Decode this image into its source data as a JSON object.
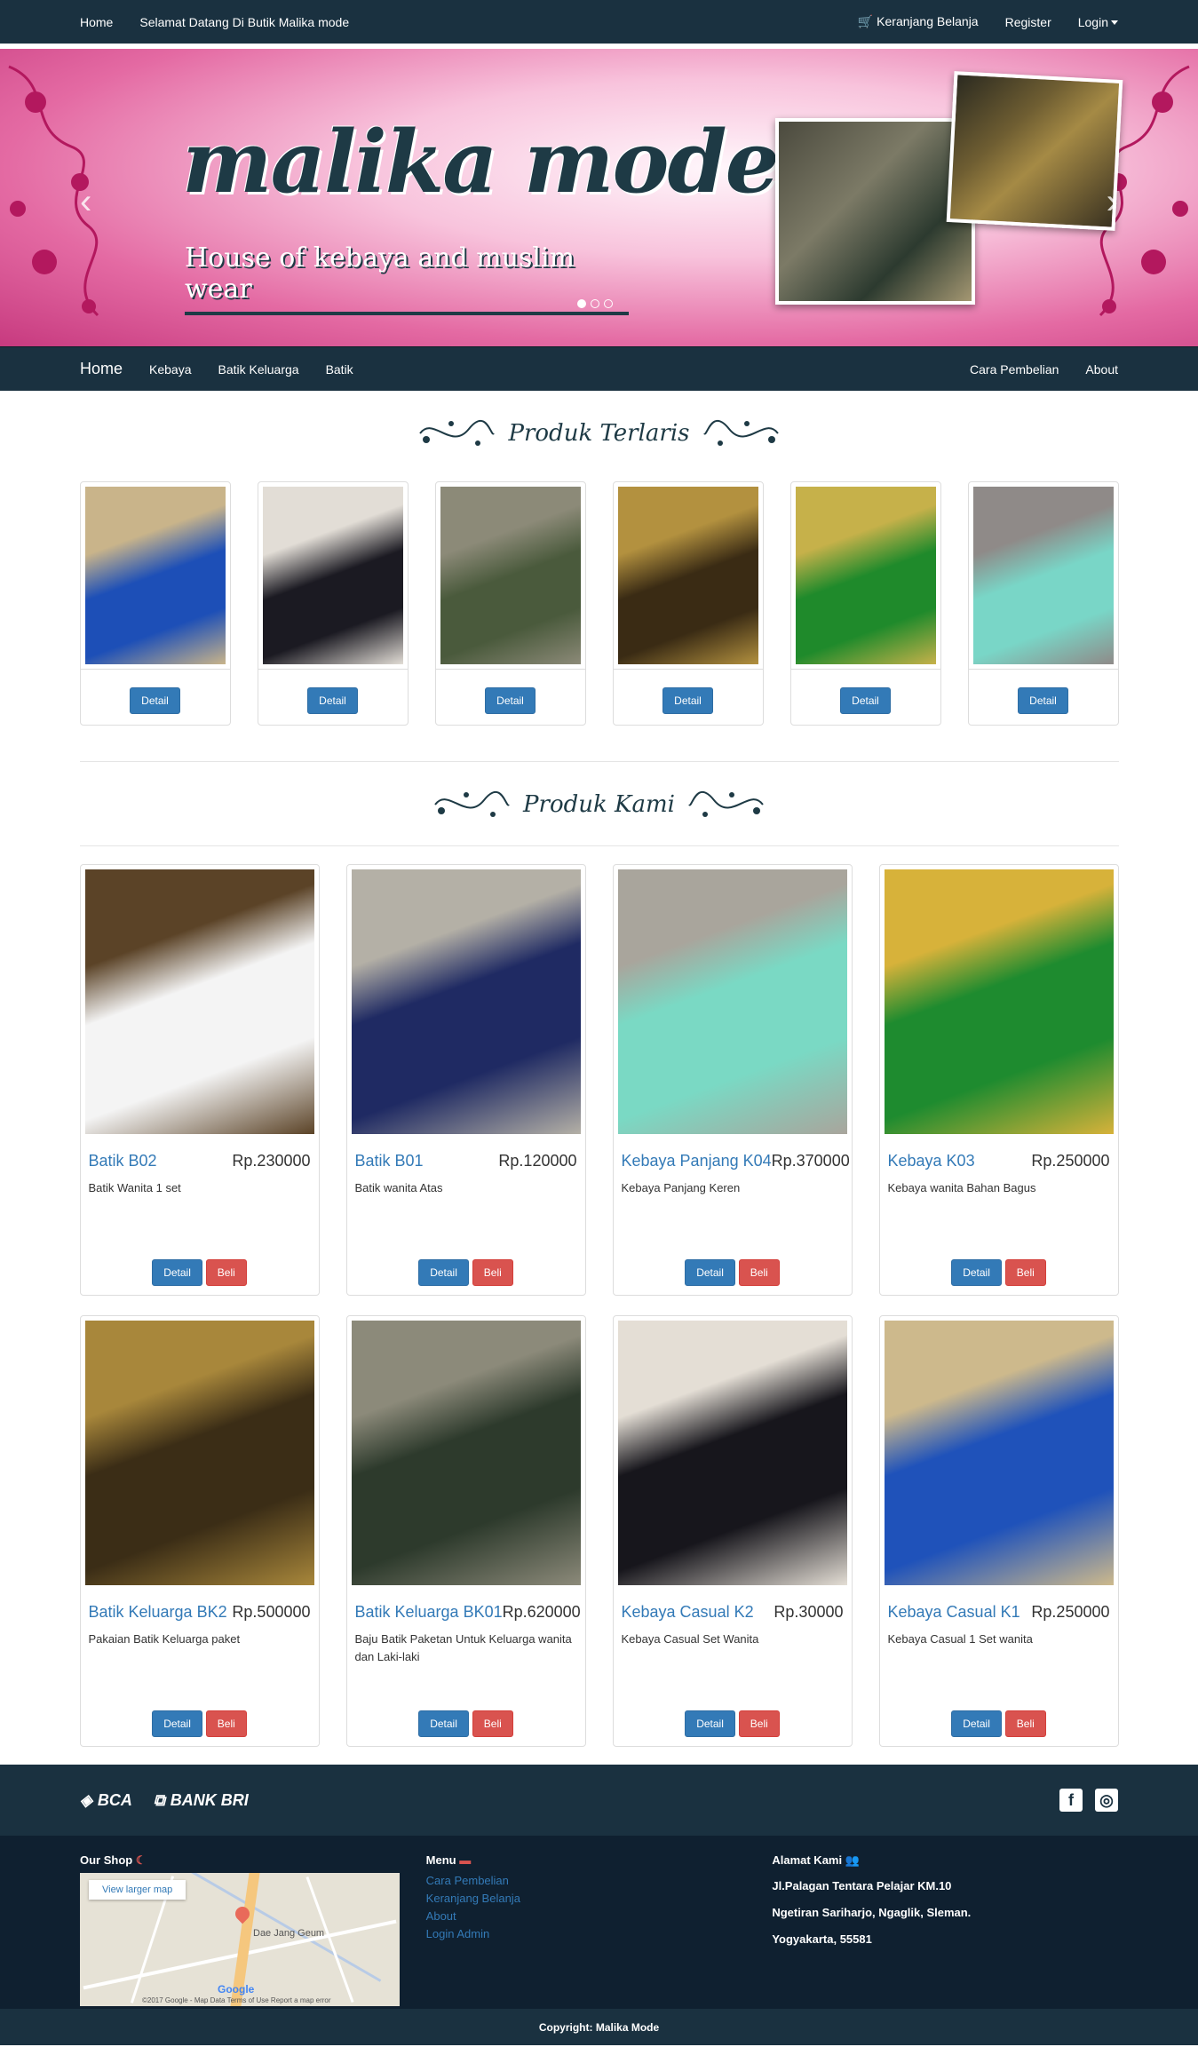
{
  "topbar": {
    "home": "Home",
    "welcome": "Selamat Datang Di Butik Malika mode",
    "cart": "Keranjang Belanja",
    "register": "Register",
    "login": "Login"
  },
  "banner": {
    "logo": "malika mode",
    "tagline": "House of kebaya and muslim wear",
    "prev": "‹",
    "next": "›"
  },
  "nav": {
    "brand": "Home",
    "items": [
      "Kebaya",
      "Batik Keluarga",
      "Batik"
    ],
    "right": [
      "Cara Pembelian",
      "About"
    ]
  },
  "best_title": "Produk Terlaris",
  "products_title": "Produk Kami",
  "detail_label": "Detail",
  "buy_label": "Beli",
  "best_colors": [
    [
      "#1d4fb7",
      "#c9b48a"
    ],
    [
      "#1b1a22",
      "#e2ddd6"
    ],
    [
      "#4a5a3c",
      "#8c8a78"
    ],
    [
      "#3a2b14",
      "#b3913f"
    ],
    [
      "#1f8a2b",
      "#c6b14a"
    ],
    [
      "#79d6c7",
      "#8f8a88"
    ]
  ],
  "products": [
    {
      "name": "Batik B02",
      "price": "Rp.230000",
      "desc": "Batik Wanita 1 set",
      "colors": [
        "#f4f4f4",
        "#5b4327"
      ]
    },
    {
      "name": "Batik B01",
      "price": "Rp.120000",
      "desc": "Batik wanita Atas",
      "colors": [
        "#1f2a63",
        "#b4b0a6"
      ]
    },
    {
      "name": "Kebaya Panjang K04",
      "price": "Rp.370000",
      "desc": "Kebaya Panjang Keren",
      "colors": [
        "#7ad9c4",
        "#a9a59c"
      ]
    },
    {
      "name": "Kebaya K03",
      "price": "Rp.250000",
      "desc": "Kebaya wanita Bahan Bagus",
      "colors": [
        "#1e8b2f",
        "#d7b23a"
      ]
    },
    {
      "name": "Batik Keluarga BK2",
      "price": "Rp.500000",
      "desc": "Pakaian Batik Keluarga paket",
      "colors": [
        "#3b2d16",
        "#a8873b"
      ]
    },
    {
      "name": "Batik Keluarga BK01",
      "price": "Rp.620000",
      "desc": "Baju Batik Paketan Untuk Keluarga wanita dan Laki-laki",
      "colors": [
        "#2d3a2c",
        "#8c8a7a"
      ]
    },
    {
      "name": "Kebaya Casual K2",
      "price": "Rp.30000",
      "desc": "Kebaya Casual Set Wanita",
      "colors": [
        "#17161c",
        "#e4ded5"
      ]
    },
    {
      "name": "Kebaya Casual K1",
      "price": "Rp.250000",
      "desc": "Kebaya Casual 1 Set wanita",
      "colors": [
        "#1f52ba",
        "#cdb98c"
      ]
    }
  ],
  "footer": {
    "banks": [
      "BCA",
      "BANK BRI"
    ],
    "shop_title": "Our Shop",
    "map_link": "View larger map",
    "map_place": "Dae Jang Geum",
    "map_attr": "©2017 Google - Map Data   Terms of Use   Report a map error",
    "map_logo": "Google",
    "menu_title": "Menu",
    "menu": [
      "Cara Pembelian",
      "Keranjang Belanja",
      "About",
      "Login Admin"
    ],
    "addr_title": "Alamat Kami",
    "address": [
      "Jl.Palagan Tentara Pelajar KM.10",
      "Ngetiran Sariharjo, Ngaglik, Sleman.",
      "Yogyakarta, 55581"
    ],
    "copyright": "Copyright: Malika Mode"
  }
}
